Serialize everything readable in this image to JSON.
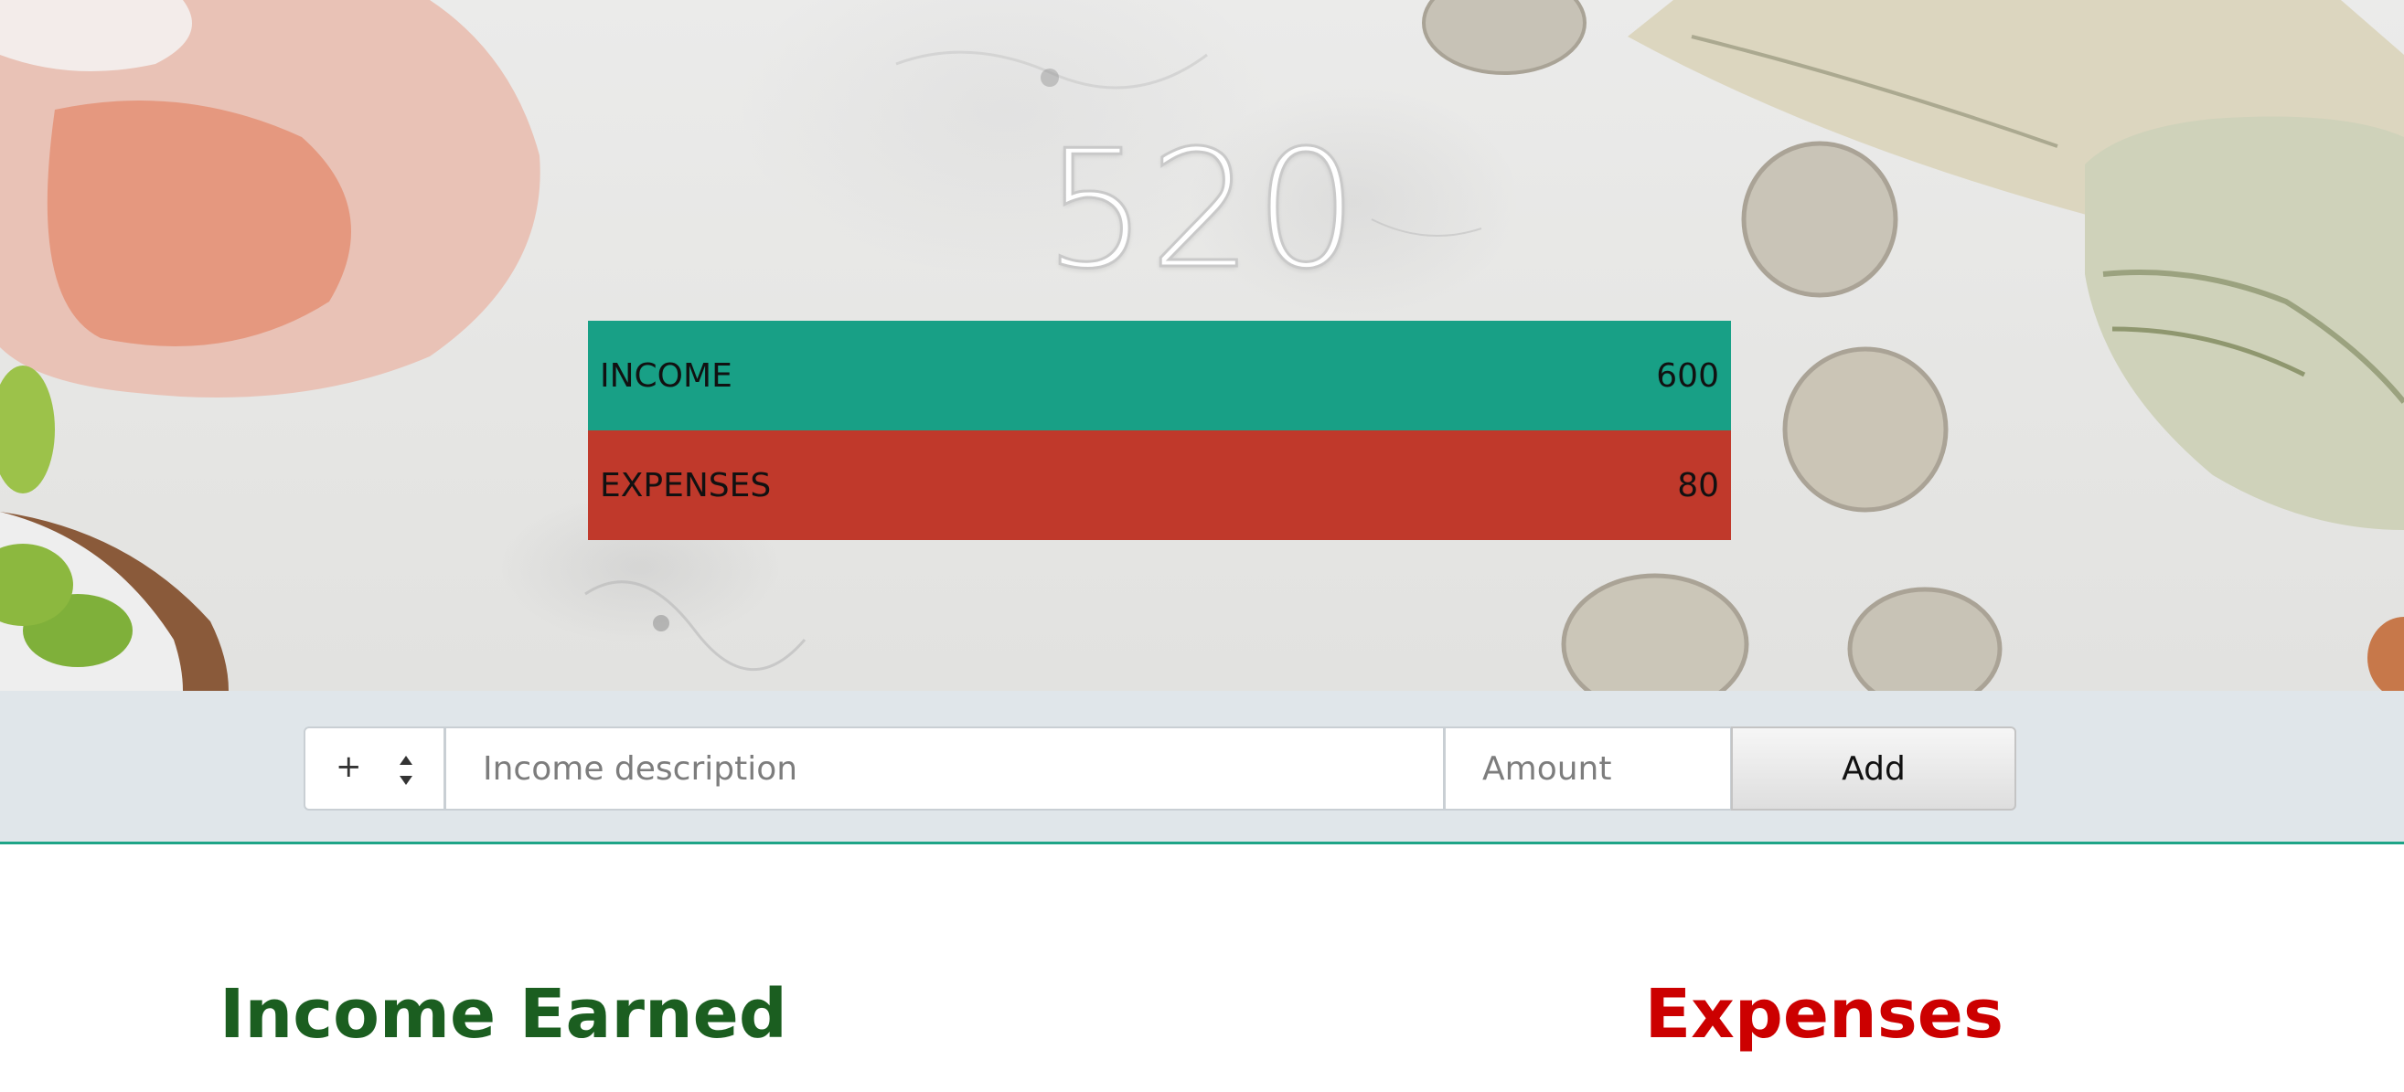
{
  "balance": "520",
  "summary": {
    "income": {
      "label": "INCOME",
      "value": "600"
    },
    "expenses": {
      "label": "EXPENSES",
      "value": "80"
    }
  },
  "input_bar": {
    "type_selected": "+",
    "type_icon": "sort-updown-icon",
    "description_placeholder": "Income description",
    "amount_placeholder": "Amount",
    "add_label": "Add"
  },
  "lists": {
    "income_title": "Income Earned",
    "expenses_title": "Expenses"
  },
  "colors": {
    "income_bar": "#18a086",
    "expenses_bar": "#c0392b",
    "income_title": "#1b5e20",
    "expenses_title": "#cc0000",
    "accent_line": "#1ea487"
  }
}
